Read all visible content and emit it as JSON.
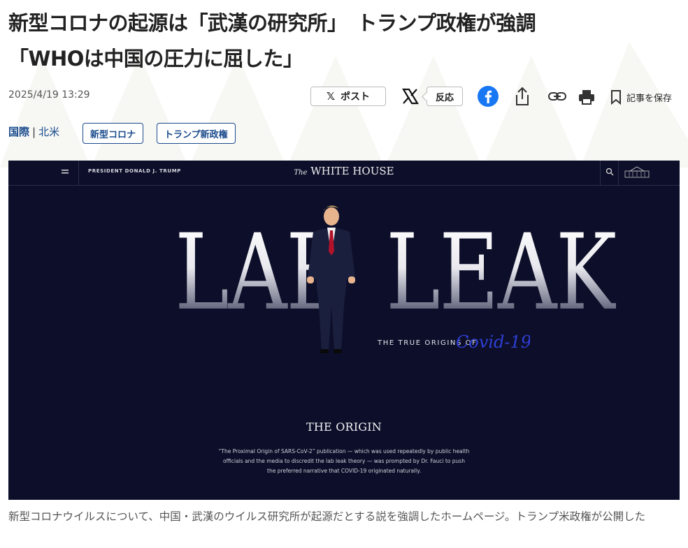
{
  "article": {
    "title_line1": "新型コロナの起源は「武漢の研究所」　トランプ政権が強調",
    "title_line2": "「WHOは中国の圧力に屈した」",
    "date": "2025/4/19 13:29",
    "share_bar": {
      "post_label": "ポスト",
      "reaction_label": "反応",
      "save_label": "記事を保存",
      "icons": [
        "x-icon",
        "facebook-icon",
        "share-icon",
        "link-icon",
        "print-icon",
        "bookmark-icon"
      ],
      "facebook_color": "#1877f2"
    },
    "breadcrumb": {
      "category": "国際",
      "subcategory": "北米"
    },
    "tags": [
      "新型コロナ",
      "トランプ新政権"
    ],
    "caption": "新型コロナウイルスについて、中国・武漢のウイルス研究所が起源だとする説を強調したホームページ。トランプ米政権が公開した"
  },
  "photo": {
    "nav": {
      "president_label": "PRESIDENT DONALD J. TRUMP",
      "site_title_prefix": "The",
      "site_title": "WHITE HOUSE"
    },
    "headline_left": "LAB",
    "headline_right": "LEAK",
    "tagline": "THE TRUE ORIGINS OF",
    "script_word": "Covid-19",
    "section_title": "THE ORIGIN",
    "section_body": "“The Proximal Origin of SARS-CoV-2” publication — which was used repeatedly by public health officials and the media to discredit the lab leak theory — was prompted by Dr. Fauci to push the preferred narrative that COVID-19 originated naturally.",
    "background_color": "#0d0f2a",
    "script_color": "#2f3fd6"
  }
}
